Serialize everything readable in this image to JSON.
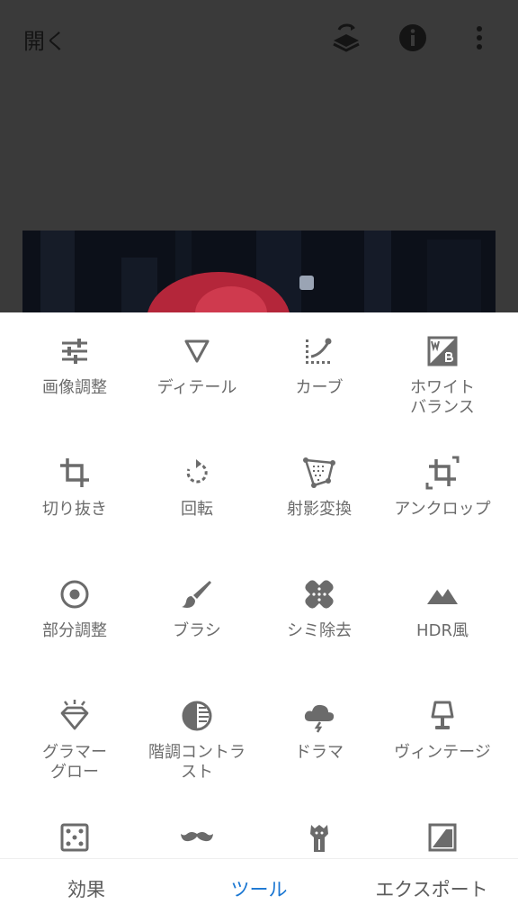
{
  "topbar": {
    "open_label": "開く",
    "icons": [
      "stack-refresh-icon",
      "info-icon",
      "more-vert-icon"
    ]
  },
  "tools": [
    {
      "label": "画像調整",
      "icon": "tune-icon"
    },
    {
      "label": "ディテール",
      "icon": "triangle-down-icon"
    },
    {
      "label": "カーブ",
      "icon": "curve-icon"
    },
    {
      "label": "ホワイト\nバランス",
      "icon": "wb-icon"
    },
    {
      "label": "切り抜き",
      "icon": "crop-icon"
    },
    {
      "label": "回転",
      "icon": "rotate-icon"
    },
    {
      "label": "射影変換",
      "icon": "perspective-icon"
    },
    {
      "label": "アンクロップ",
      "icon": "uncrop-icon"
    },
    {
      "label": "部分調整",
      "icon": "selective-icon"
    },
    {
      "label": "ブラシ",
      "icon": "brush-icon"
    },
    {
      "label": "シミ除去",
      "icon": "healing-icon"
    },
    {
      "label": "HDR風",
      "icon": "mountains-icon"
    },
    {
      "label": "グラマー\nグロー",
      "icon": "diamond-glow-icon"
    },
    {
      "label": "階調コントラ\nスト",
      "icon": "tonal-contrast-icon"
    },
    {
      "label": "ドラマ",
      "icon": "cloud-drama-icon"
    },
    {
      "label": "ヴィンテージ",
      "icon": "lamp-icon"
    },
    {
      "label": "",
      "icon": "dice-icon"
    },
    {
      "label": "",
      "icon": "mustache-icon"
    },
    {
      "label": "",
      "icon": "guitar-icon"
    },
    {
      "label": "",
      "icon": "frame-icon"
    }
  ],
  "bottom_tabs": [
    {
      "label": "効果"
    },
    {
      "label": "ツール"
    },
    {
      "label": "エクスポート"
    }
  ],
  "colors": {
    "accent": "#1976d2",
    "icon": "#6b6b6b",
    "tab_text": "#5c5c5c",
    "overlay": "#3a3a3a"
  }
}
